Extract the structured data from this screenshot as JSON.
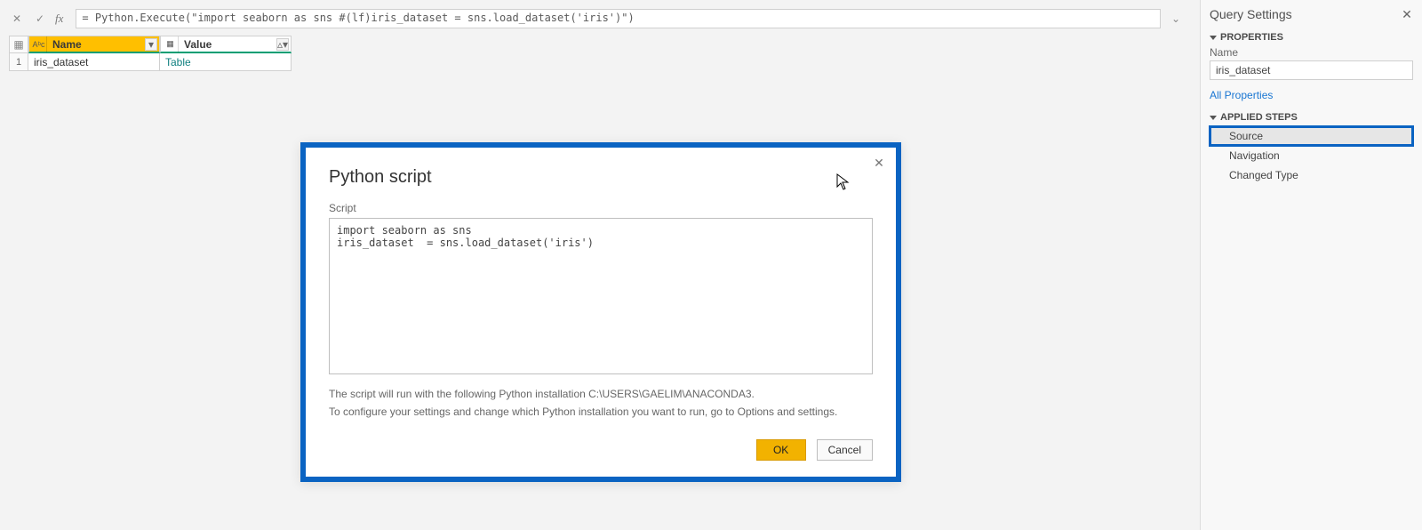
{
  "formula": {
    "cancel_glyph": "✕",
    "accept_glyph": "✓",
    "fx_label": "fx",
    "text": "= Python.Execute(\"import seaborn as sns #(lf)iris_dataset  = sns.load_dataset('iris')\")",
    "dropdown_glyph": "⌄"
  },
  "grid": {
    "selector_glyph": "▦",
    "columns": [
      {
        "type_icon": "Aᵇc",
        "label": "Name",
        "dd_glyph": "▾"
      },
      {
        "type_icon": "▦",
        "label": "Value",
        "dd_glyph": "▵▾"
      }
    ],
    "rows": [
      {
        "num": "1",
        "cells": [
          "iris_dataset",
          "Table"
        ]
      }
    ]
  },
  "dialog": {
    "title": "Python script",
    "script_label": "Script",
    "script_text": "import seaborn as sns\niris_dataset  = sns.load_dataset('iris')",
    "info_line1": "The script will run with the following Python installation C:\\USERS\\GAELIM\\ANACONDA3.",
    "info_line2": "To configure your settings and change which Python installation you want to run, go to Options and settings.",
    "ok_label": "OK",
    "cancel_label": "Cancel",
    "close_glyph": "✕"
  },
  "right_panel": {
    "header": "Query Settings",
    "close_glyph": "✕",
    "properties_title": "PROPERTIES",
    "name_label": "Name",
    "name_value": "iris_dataset",
    "all_properties": "All Properties",
    "applied_steps_title": "APPLIED STEPS",
    "steps": [
      {
        "label": "Source",
        "selected": true
      },
      {
        "label": "Navigation",
        "selected": false
      },
      {
        "label": "Changed Type",
        "selected": false
      }
    ]
  }
}
